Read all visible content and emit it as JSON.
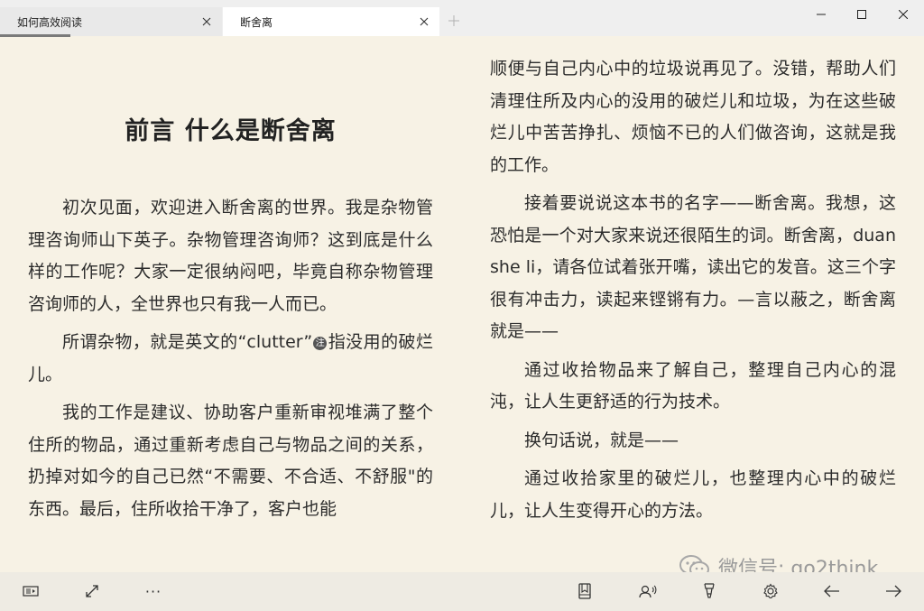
{
  "tabs": [
    {
      "label": "如何高效阅读"
    },
    {
      "label": "断舍离"
    }
  ],
  "left_page": {
    "chapter_title": "前言  什么是断舍离",
    "paragraphs": [
      "初次见面，欢迎进入断舍离的世界。我是杂物管理咨询师山下英子。杂物管理咨询师？这到底是什么样的工作呢？大家一定很纳闷吧，毕竟自称杂物管理咨询师的人，全世界也只有我一人而已。",
      "所谓杂物，就是英文的“clutter”",
      "指没用的破烂儿。",
      "我的工作是建议、协助客户重新审视堆满了整个住所的物品，通过重新考虑自己与物品之间的关系，扔掉对如今的自己已然“不需要、不合适、不舒服\"的东西。最后，住所收拾干净了，客户也能"
    ],
    "note_marker": "注"
  },
  "right_page": {
    "paragraphs": [
      "顺便与自己内心中的垃圾说再见了。没错，帮助人们清理住所及内心的没用的破烂儿和垃圾，为在这些破烂儿中苦苦挣扎、烦恼不已的人们做咨询，这就是我的工作。",
      "接着要说说这本书的名字——断舍离。我想，这恐怕是一个对大家来说还很陌生的词。断舍离，duan she li，请各位试着张开嘴，读出它的发音。这三个字很有冲击力，读起来铿锵有力。—言以蔽之，断舍离就是——",
      "通过收拾物品来了解自己，整理自己内心的混沌，让人生更舒适的行为技术。",
      "换句话说，就是——",
      "通过收拾家里的破烂儿，也整理内心中的破烂儿，让人生变得开心的方法。"
    ]
  },
  "watermark": {
    "text": "微信号: go2think"
  },
  "toolbar": {
    "more_label": "···"
  },
  "icons": {
    "toc": "table-of-contents-icon",
    "fullscreen": "expand-icon",
    "more": "more-dots-icon",
    "bookmark": "bookmark-icon",
    "read_aloud": "read-aloud-icon",
    "highlight": "highlighter-icon",
    "settings": "gear-icon",
    "prev": "arrow-left-icon",
    "next": "arrow-right-icon"
  },
  "colors": {
    "page_background": "#f7f2e5",
    "toolbar_background": "#eeebe3",
    "tab_active": "#ffffff",
    "tab_inactive": "#e9e9e9",
    "watermark": "#9a9a9a"
  }
}
